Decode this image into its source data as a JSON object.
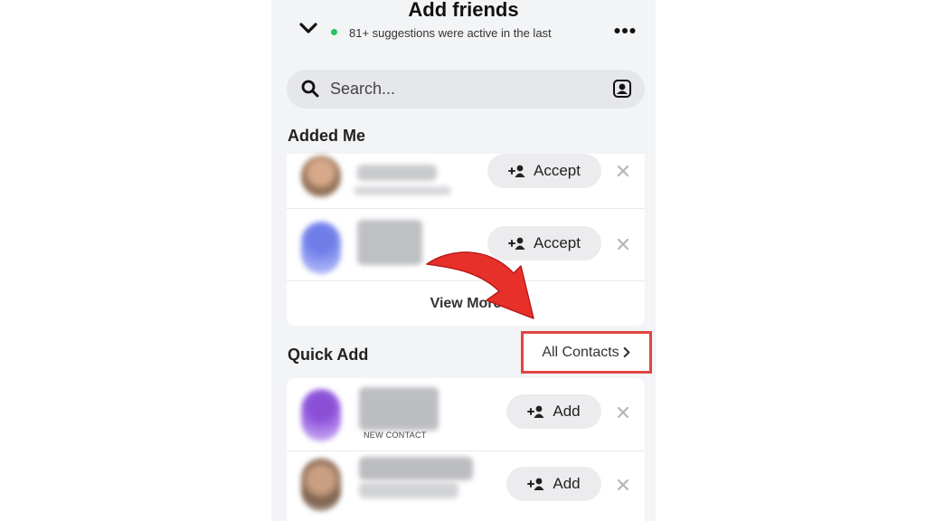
{
  "header": {
    "title": "Add friends",
    "subtitle": "81+ suggestions were active in the last"
  },
  "search": {
    "placeholder": "Search..."
  },
  "added_me": {
    "section_title": "Added Me",
    "accept_label": "Accept",
    "view_more_label": "View More"
  },
  "quick_add": {
    "section_title": "Quick Add",
    "all_contacts_label": "All Contacts",
    "add_label": "Add",
    "new_contact_label": "NEW CONTACT"
  },
  "colors": {
    "background": "#f3f4f6",
    "highlight": "#e0463f",
    "arrow": "#e8302b",
    "active": "#22c55e"
  },
  "icons": [
    "chevron-down-icon",
    "more-dots-icon",
    "search-icon",
    "contact-card-icon",
    "add-friend-icon",
    "close-icon",
    "chevron-right-icon",
    "arrow-annotation"
  ]
}
